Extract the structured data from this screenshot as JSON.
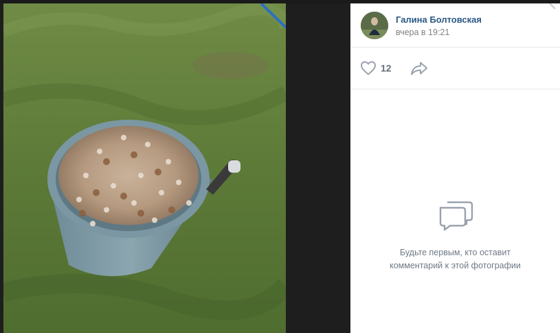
{
  "post": {
    "author_name": "Галина Болтовская",
    "time": "вчера в 19:21"
  },
  "actions": {
    "like_icon": "heart-outline-icon",
    "like_count": "12",
    "share_icon": "share-arrow-icon"
  },
  "comments": {
    "empty_icon": "chat-bubbles-icon",
    "empty_line1": "Будьте первым, кто оставит",
    "empty_line2": "комментарий к этой фотографии"
  },
  "colors": {
    "link": "#2a5885",
    "muted": "#828282",
    "icon": "#99a2ad",
    "divider": "#e7e8ec"
  }
}
